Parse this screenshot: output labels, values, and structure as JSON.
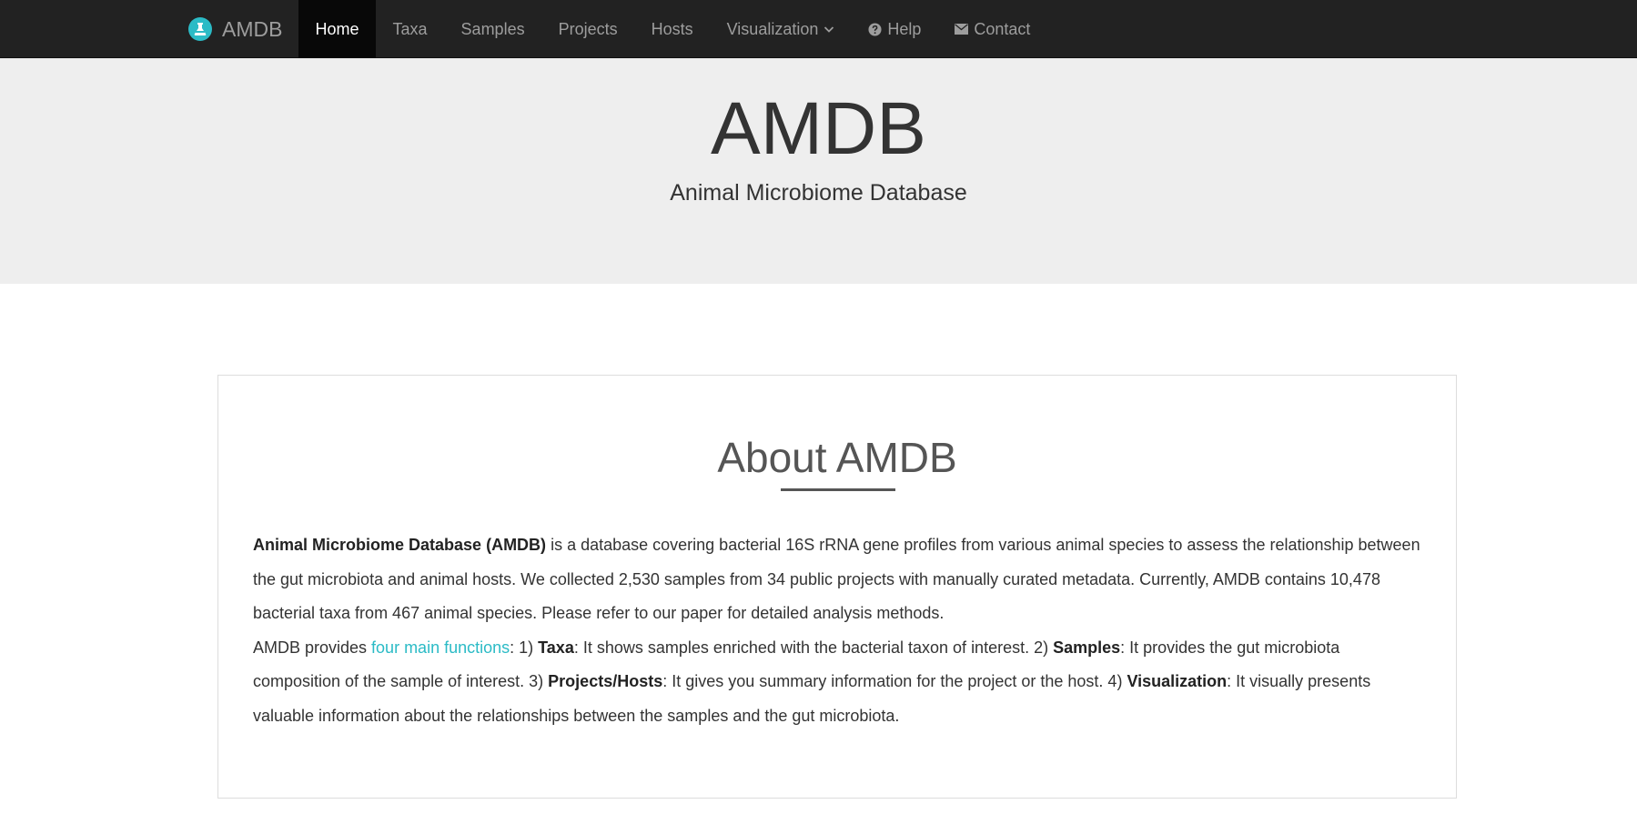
{
  "brand": {
    "name": "AMDB",
    "logo_icon": "flask-icon",
    "logo_color": "#2bbbc6"
  },
  "nav": {
    "items": [
      {
        "label": "Home",
        "active": true
      },
      {
        "label": "Taxa"
      },
      {
        "label": "Samples"
      },
      {
        "label": "Projects"
      },
      {
        "label": "Hosts"
      },
      {
        "label": "Visualization",
        "icon": "chevron-down-icon"
      },
      {
        "label": "Help",
        "icon": "question-circle-icon"
      },
      {
        "label": "Contact",
        "icon": "envelope-icon"
      }
    ]
  },
  "hero": {
    "title": "AMDB",
    "subtitle": "Animal Microbiome Database"
  },
  "about": {
    "heading": "About AMDB",
    "p1_bold": "Animal Microbiome Database (AMDB)",
    "p1_text": " is a database covering bacterial 16S rRNA gene profiles from various animal species to assess the relationship between the gut microbiota and animal hosts. We collected 2,530 samples from 34 public projects with manually curated metadata. Currently, AMDB contains 10,478 bacterial taxa from 467 animal species. Please refer to our paper for detailed analysis methods.",
    "p2_intro": "AMDB provides ",
    "p2_link": "four main functions",
    "p2_t1": ": 1) ",
    "p2_b1": "Taxa",
    "p2_t2": ": It shows samples enriched with the bacterial taxon of interest. 2) ",
    "p2_b2": "Samples",
    "p2_t3": ": It provides the gut microbiota composition of the sample of interest. 3) ",
    "p2_b3": "Projects/Hosts",
    "p2_t4": ": It gives you summary information for the project or the host. 4) ",
    "p2_b4": "Visualization",
    "p2_t5": ": It visually presents valuable information about the relationships between the samples and the gut microbiota."
  },
  "colors": {
    "navbar_bg": "#222222",
    "nav_active_bg": "#080808",
    "hero_bg": "#eeeeee",
    "link": "#2bbbc6"
  }
}
